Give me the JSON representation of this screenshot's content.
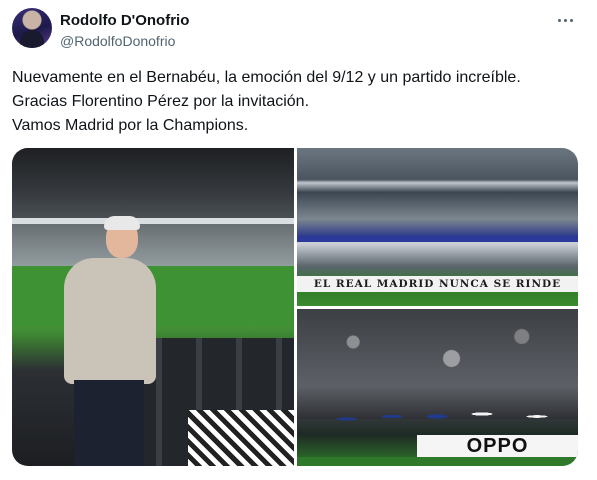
{
  "author": {
    "name": "Rodolfo D'Onofrio",
    "handle": "@RodolfoDonofrio"
  },
  "tweet": {
    "lines": [
      "Nuevamente en el Bernabéu, la emoción del 9/12 y un partido increíble.",
      "Gracias Florentino Pérez por la invitación.",
      "Vamos Madrid por la Champions."
    ]
  },
  "media": {
    "banner_text": "EL REAL MADRID NUNCA SE RINDE",
    "sponsor_text": "OPPO"
  },
  "icons": {
    "more": "more-horizontal-icon"
  },
  "colors": {
    "text": "#0f1419",
    "secondary_text": "#536471",
    "background": "#ffffff"
  }
}
